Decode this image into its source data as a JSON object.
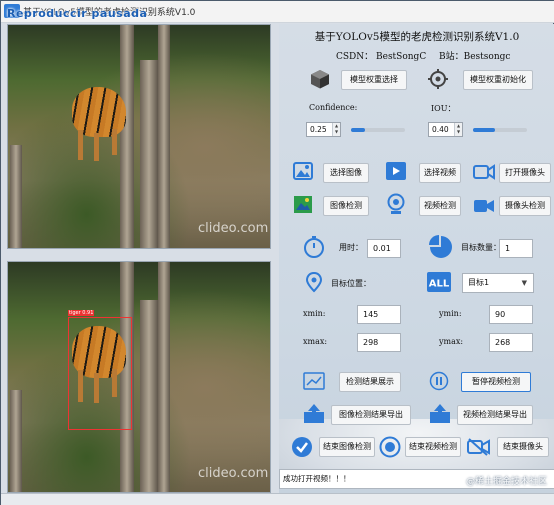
{
  "window": {
    "title": "基于YOLOv5模型的老虎检测识别系统V1.0",
    "watermark": "Reproduccir pausada"
  },
  "panel": {
    "title": "基于YOLOv5模型的老虎检测识别系统V1.0",
    "csdn": "CSDN：  BestSongC",
    "bilibili": "B站：Bestsongc"
  },
  "model": {
    "select_label": "模型权重选择",
    "init_label": "模型权重初始化"
  },
  "params": {
    "confidence_label": "Confidence:",
    "confidence_value": "0.25",
    "confidence_level": 0.25,
    "iou_label": "IOU：",
    "iou_value": "0.40",
    "iou_level": 0.4
  },
  "buttons": {
    "select_image": "选择图像",
    "select_video": "选择视频",
    "open_camera": "打开摄像头",
    "image_detect": "图像检测",
    "video_detect": "视频检测",
    "camera_detect": "摄像头检测",
    "show_results": "检测结果展示",
    "pause_video": "暂停视频检测",
    "export_image": "图像检测结果导出",
    "export_video": "视频检测结果导出",
    "end_image": "结束图像检测",
    "end_video": "结束视频检测",
    "end_camera": "结束摄像头"
  },
  "stats": {
    "time_label": "用时：",
    "time_value": "0.01",
    "count_label": "目标数量：",
    "count_value": "1",
    "position_label": "目标位置：",
    "target_select": "目标1",
    "xmin_label": "xmin:",
    "xmin_value": "145",
    "ymin_label": "ymin:",
    "ymin_value": "90",
    "xmax_label": "xmax:",
    "xmax_value": "298",
    "ymax_label": "ymax:",
    "ymax_value": "268"
  },
  "status": {
    "message": "成功打开视频！！！"
  },
  "overlay": {
    "clideo": "clideo.com",
    "detection_label": "tiger 0.91",
    "source": "@稀土掘金技术社区"
  },
  "colors": {
    "accent": "#2f7bd6",
    "detection_box": "#e33333"
  }
}
